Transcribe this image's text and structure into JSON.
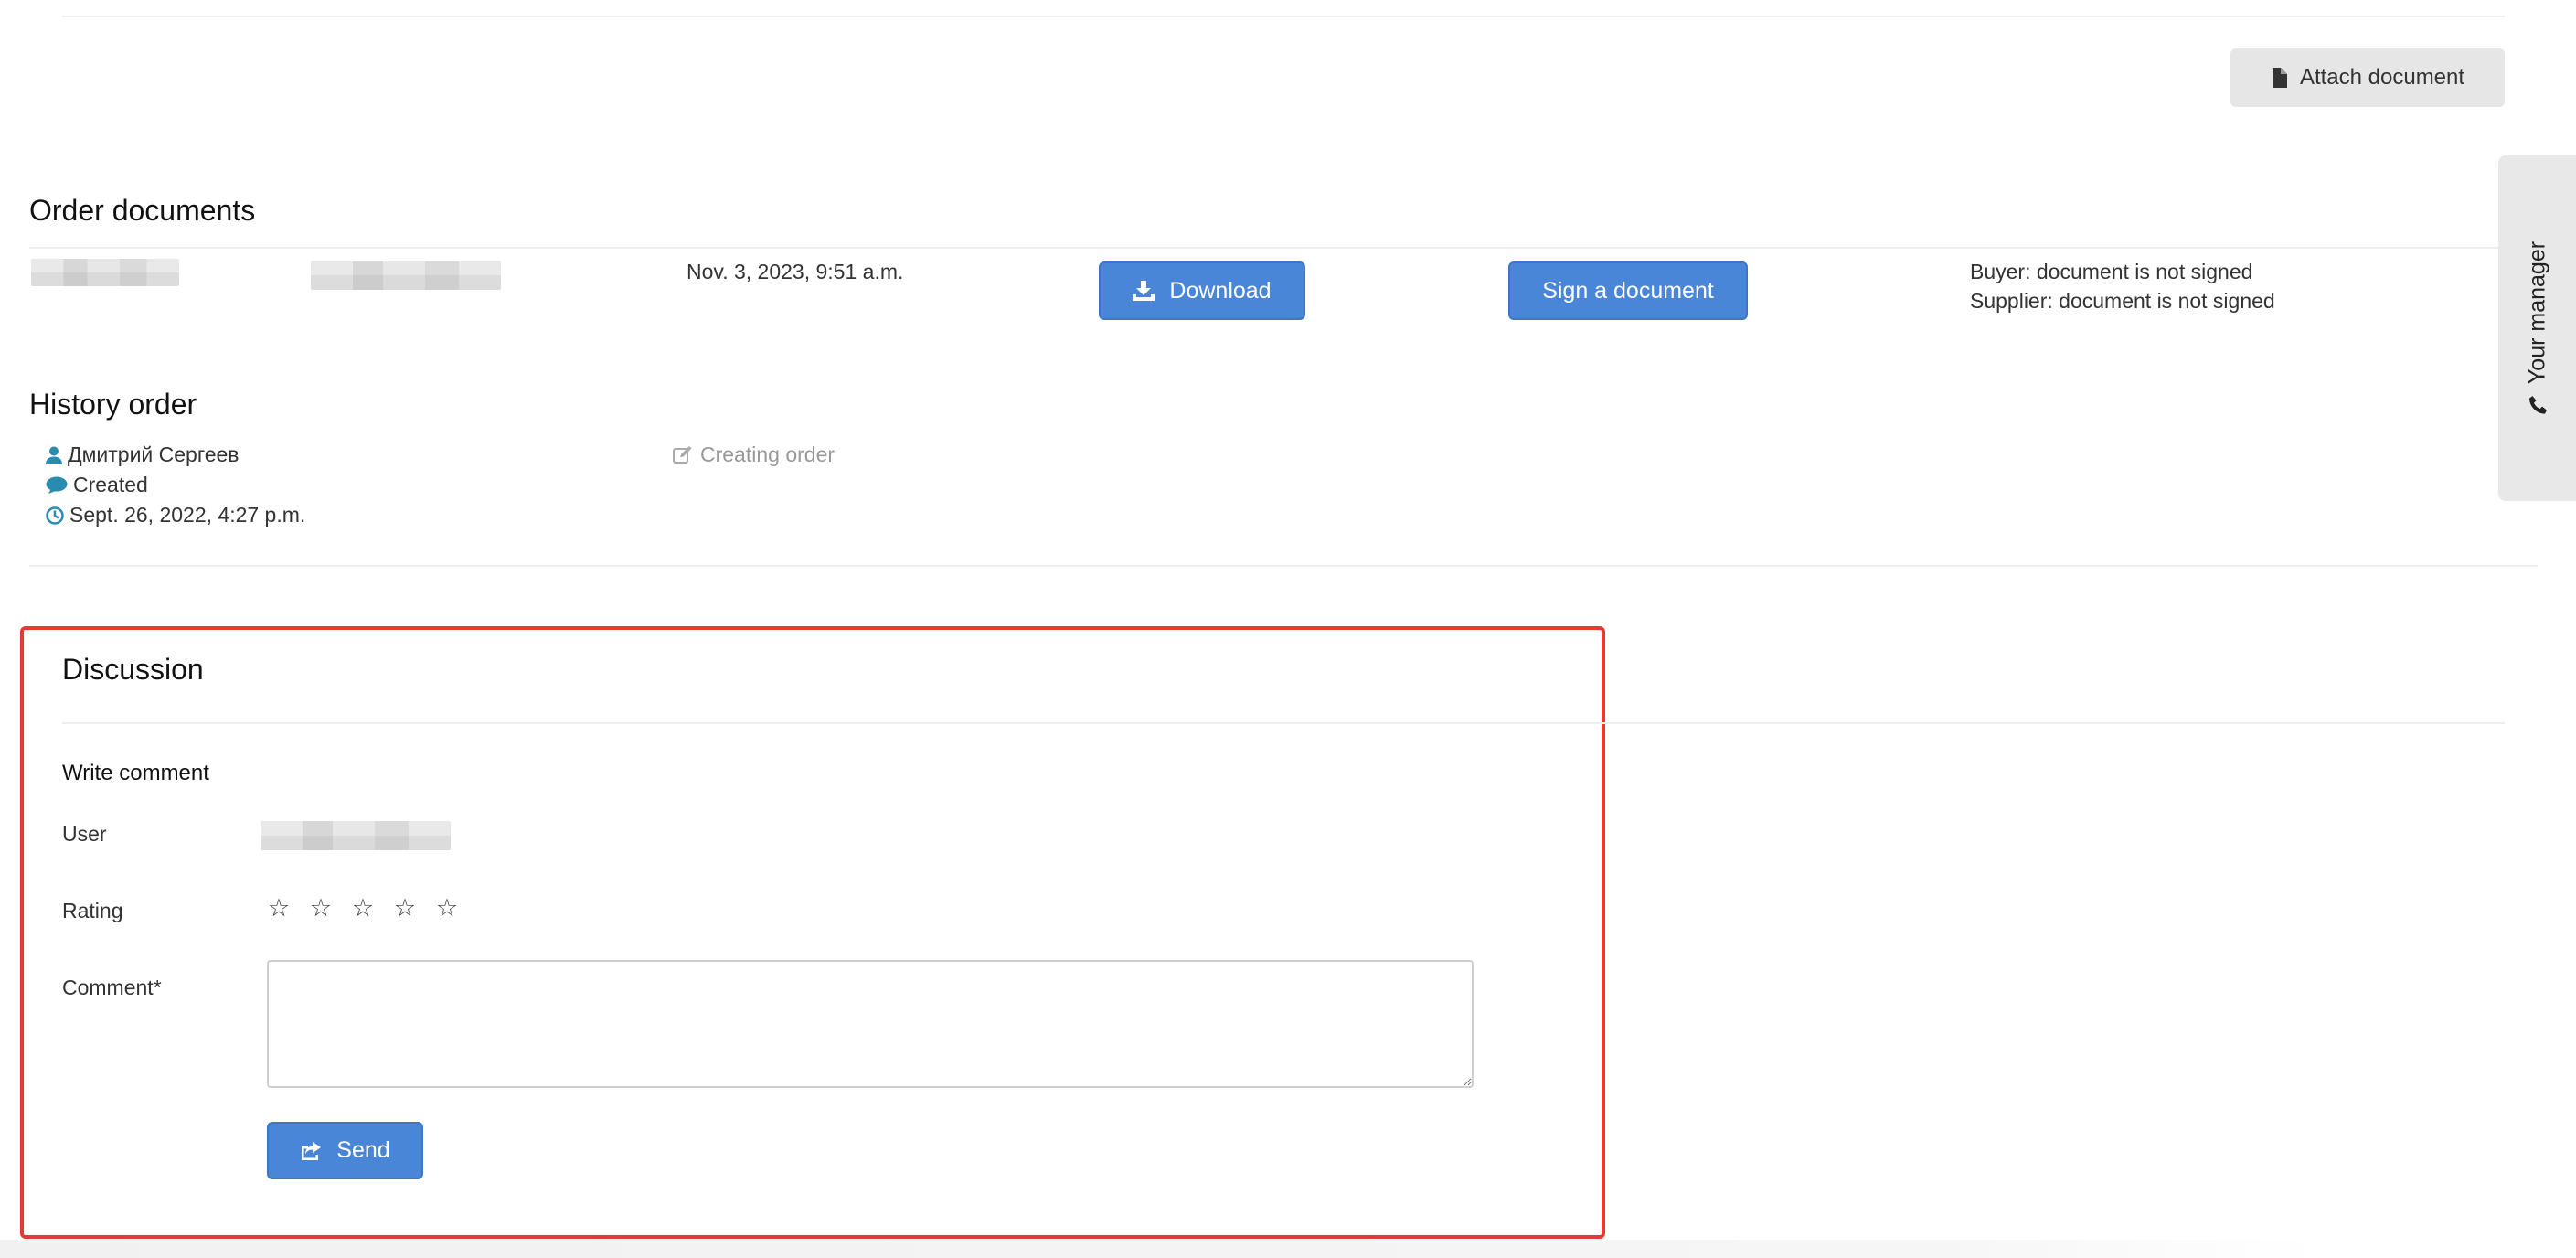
{
  "attach_button": {
    "label": "Attach document",
    "icon": "file-icon"
  },
  "order_documents": {
    "title": "Order documents",
    "row": {
      "date": "Nov. 3, 2023, 9:51 a.m.",
      "download_label": "Download",
      "sign_label": "Sign a document",
      "buyer_status": "Buyer: document is not signed",
      "supplier_status": "Supplier: document is not signed"
    }
  },
  "history": {
    "title": "History order",
    "user": "Дмитрий Сергеев",
    "status": "Created",
    "timestamp": "Sept. 26, 2022, 4:27 p.m.",
    "action": "Creating order"
  },
  "manager_tab": {
    "label": "Your manager",
    "icon": "phone-icon"
  },
  "discussion": {
    "title": "Discussion",
    "write_comment": "Write comment",
    "user_label": "User",
    "rating_label": "Rating",
    "rating_max": 5,
    "rating_value": 0,
    "comment_label": "Comment*",
    "comment_value": "",
    "send_label": "Send"
  },
  "colors": {
    "primary": "#4a86d8",
    "highlight_border": "#e53935",
    "icon_teal": "#2a8bb0"
  }
}
